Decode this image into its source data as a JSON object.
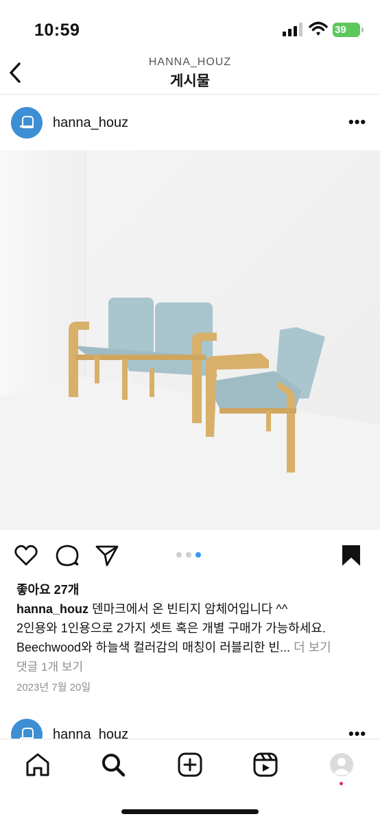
{
  "status_bar": {
    "time": "10:59",
    "battery": "39"
  },
  "nav": {
    "account": "HANNA_HOUZ",
    "title": "게시물"
  },
  "post": {
    "username": "hanna_houz",
    "photo_description_icon": "photo",
    "carousel": {
      "count": 3,
      "active_index": 2
    },
    "likes": "좋아요 27개",
    "caption": {
      "username": "hanna_houz",
      "line1": "덴마크에서 온 빈티지 암체어입니다 ^^",
      "line2": "2인용와 1인용으로 2가지 셋트 혹은 개별 구매가 가능하세요.",
      "line3": "Beechwood와 하늘색 컬러감의 매칭이 러블리한 빈...",
      "more": "더 보기"
    },
    "comments_link": "댓글 1개 보기",
    "date": "2023년 7월 20일"
  },
  "next_post": {
    "username": "hanna_houz"
  },
  "icons": {
    "like": "heart-icon",
    "comment": "comment-icon",
    "share": "paper-plane-icon",
    "save": "bookmark-icon",
    "home": "home-icon",
    "search": "search-icon",
    "create": "plus-square-icon",
    "reels": "reels-icon",
    "profile": "profile-avatar-icon"
  },
  "colors": {
    "accent_blue": "#3797f0",
    "notification": "#e0304e",
    "secondary_text": "#8e8e8e"
  }
}
